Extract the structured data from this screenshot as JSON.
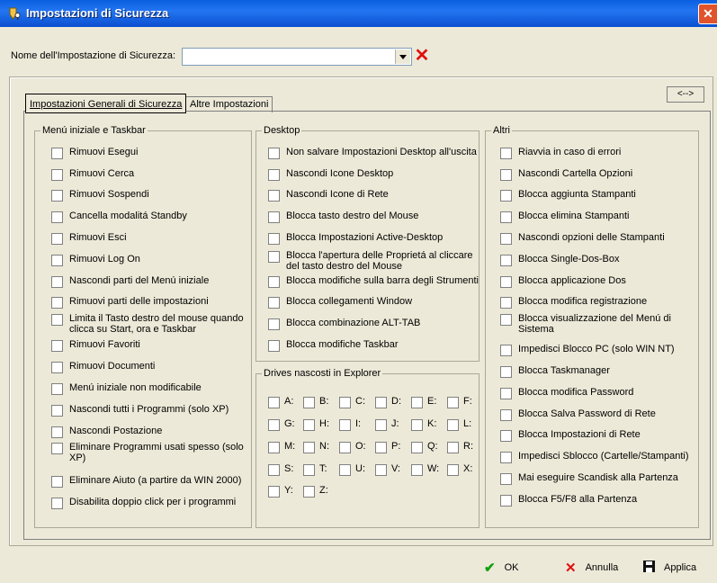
{
  "window": {
    "title": "Impostazioni di Sicurezza",
    "close": "✕"
  },
  "name_field": {
    "label": "Nome dell'Impostazione di Sicurezza:",
    "value": ""
  },
  "tabs": [
    "Impostazioni Generali di Sicurezza",
    "Altre Impostazioni"
  ],
  "swap_label": "<-->",
  "groups": {
    "start": {
      "legend": "Menú iniziale e Taskbar",
      "items": [
        "Rimuovi Esegui",
        "Rimuovi Cerca",
        "Rimuovi Sospendi",
        "Cancella modalitá Standby",
        "Rimuovi Esci",
        "Rimuovi Log On",
        "Nascondi parti del Menú iniziale",
        "Rimuovi parti delle impostazioni",
        "Limita il Tasto destro del mouse quando\nclicca su Start, ora e Taskbar",
        "Rimuovi Favoriti",
        "Rimuovi Documenti",
        "Menú iniziale non modificabile",
        "Nascondi tutti i Programmi (solo XP)",
        "Nascondi Postazione",
        "Eliminare Programmi usati spesso (solo\nXP)",
        "Eliminare Aiuto (a partire da WIN 2000)",
        "Disabilita doppio click per i programmi"
      ]
    },
    "desktop": {
      "legend": "Desktop",
      "items": [
        "Non salvare Impostazioni Desktop all'uscita",
        "Nascondi Icone Desktop",
        "Nascondi Icone di Rete",
        "Blocca tasto destro del Mouse",
        "Blocca Impostazioni Active-Desktop",
        "Blocca l'apertura delle Proprietá al cliccare\ndel tasto destro del Mouse",
        "Blocca modifiche sulla barra degli Strumenti",
        "Blocca collegamenti Window",
        "Blocca combinazione ALT-TAB",
        "Blocca modifiche Taskbar"
      ]
    },
    "drives": {
      "legend": "Drives nascosti in Explorer",
      "items": [
        "A:",
        "B:",
        "C:",
        "D:",
        "E:",
        "F:",
        "G:",
        "H:",
        "I:",
        "J:",
        "K:",
        "L:",
        "M:",
        "N:",
        "O:",
        "P:",
        "Q:",
        "R:",
        "S:",
        "T:",
        "U:",
        "V:",
        "W:",
        "X:",
        "Y:",
        "Z:"
      ]
    },
    "altri": {
      "legend": "Altri",
      "items": [
        "Riavvia in caso di errori",
        "Nascondi Cartella Opzioni",
        "Blocca aggiunta Stampanti",
        "Blocca elimina Stampanti",
        "Nascondi opzioni delle Stampanti",
        "Blocca Single-Dos-Box",
        "Blocca applicazione Dos",
        "Blocca modifica registrazione",
        "Blocca visualizzazione del Menú di\nSistema",
        "Impedisci Blocco PC (solo WIN NT)",
        "Blocca Taskmanager",
        "Blocca modifica Password",
        "Blocca Salva Password di Rete",
        "Blocca Impostazioni di Rete",
        "Impedisci Sblocco (Cartelle/Stampanti)",
        "Mai eseguire Scandisk alla Partenza",
        "Blocca F5/F8 alla Partenza"
      ]
    }
  },
  "buttons": {
    "ok": "OK",
    "cancel": "Annulla",
    "apply": "Applica"
  },
  "colors": {
    "title_bar": "#0a5fe0",
    "ok_icon": "#10a010",
    "cancel_icon": "#e01010",
    "face": "#ece9d8"
  },
  "icons": {
    "title": "shield-key-icon",
    "ok": "checkmark-icon",
    "cancel": "x-icon",
    "apply": "floppy-disk-icon"
  }
}
